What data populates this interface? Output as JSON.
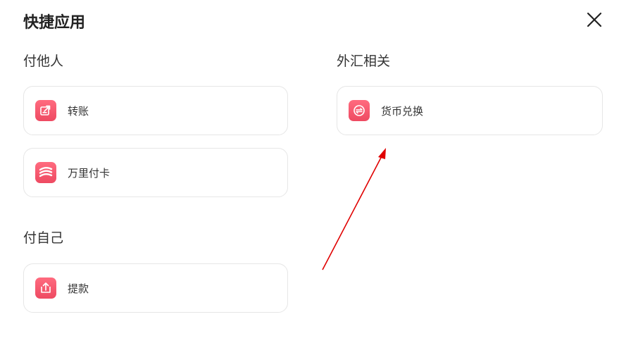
{
  "dialog": {
    "title": "快捷应用"
  },
  "sections": {
    "pay_others": {
      "label": "付他人",
      "items": [
        {
          "label": "转账",
          "icon": "transfer-icon"
        },
        {
          "label": "万里付卡",
          "icon": "card-icon"
        }
      ]
    },
    "pay_self": {
      "label": "付自己",
      "items": [
        {
          "label": "提款",
          "icon": "withdraw-icon"
        }
      ]
    },
    "forex": {
      "label": "外汇相关",
      "items": [
        {
          "label": "货币兑换",
          "icon": "currency-exchange-icon"
        }
      ]
    }
  },
  "colors": {
    "icon_gradient_top": "#ff6b7f",
    "icon_gradient_bottom": "#ee4a62",
    "annotation_arrow": "#e00000"
  }
}
